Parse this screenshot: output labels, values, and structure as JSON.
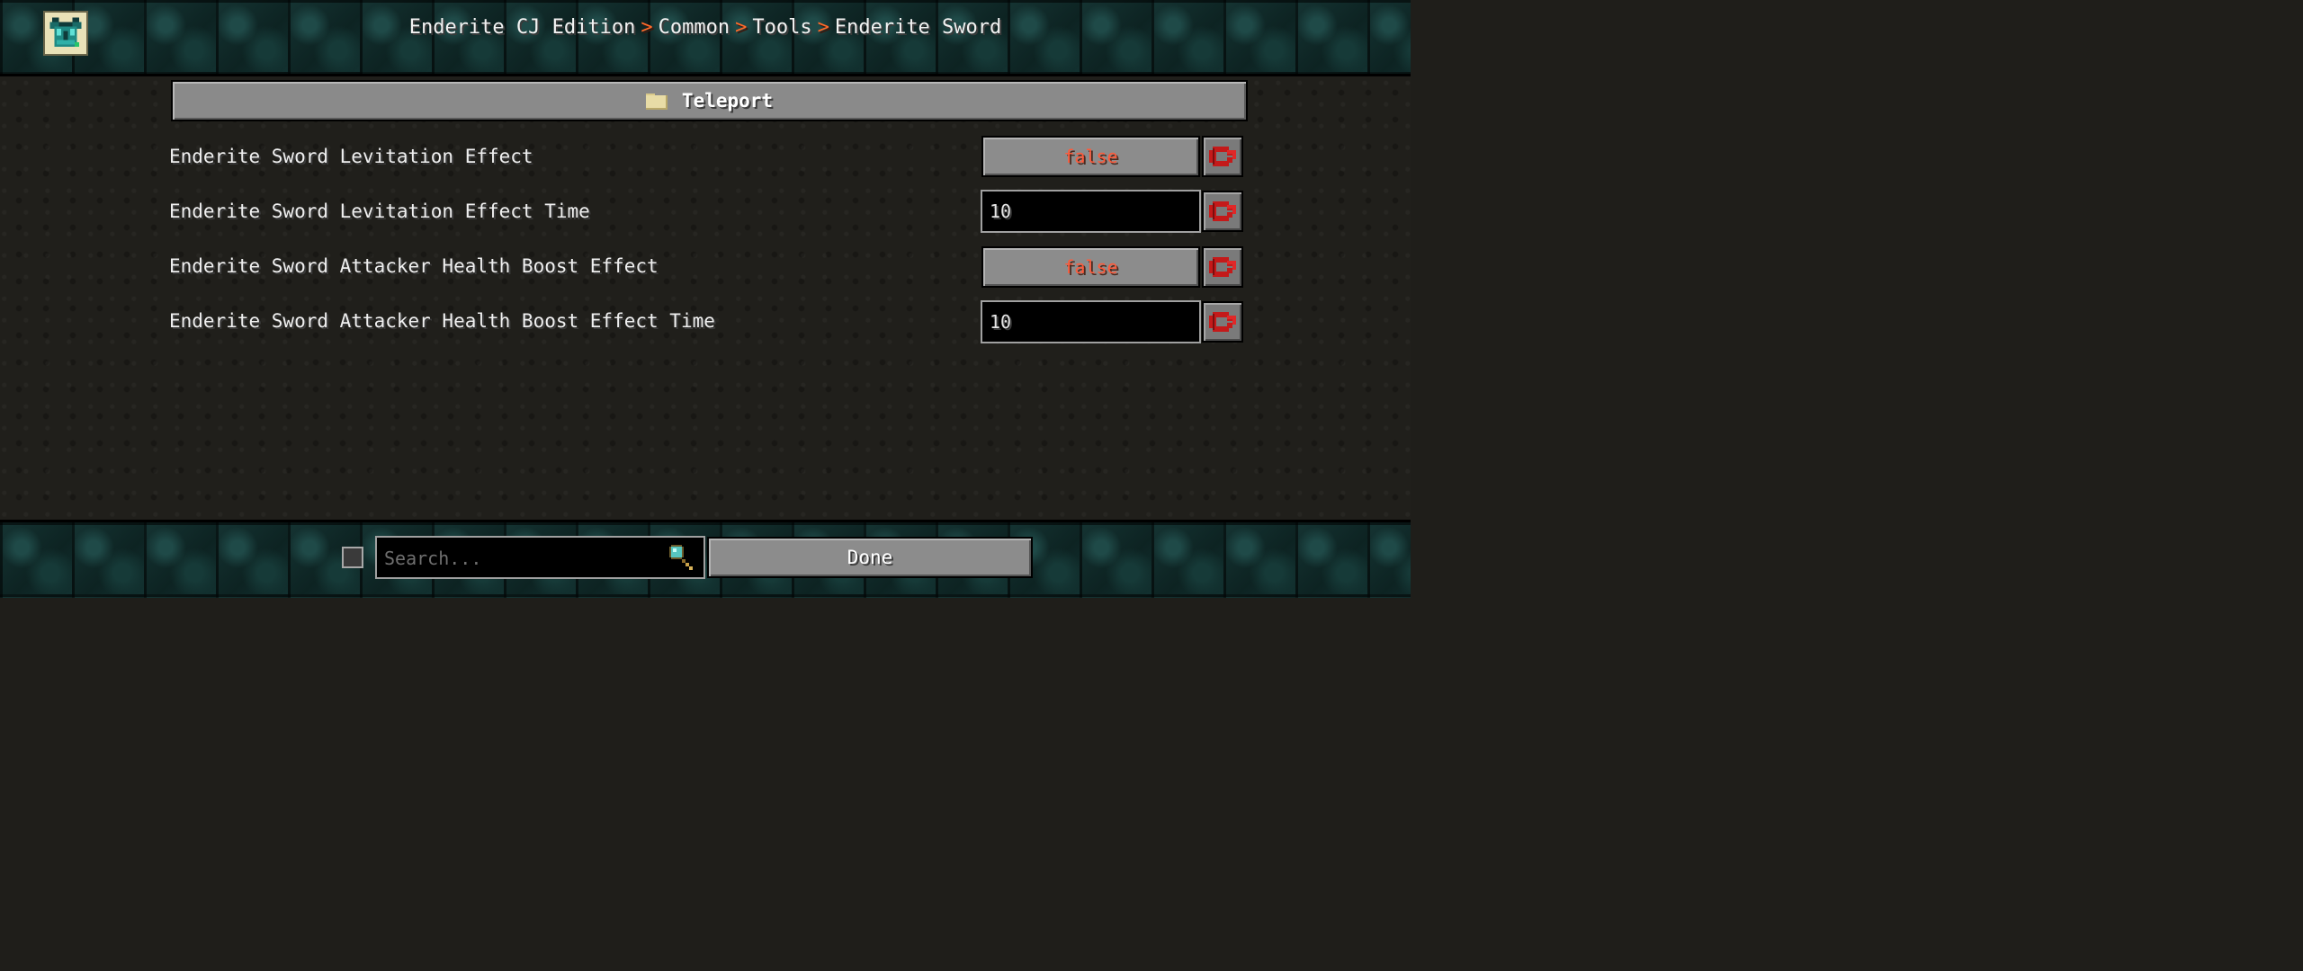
{
  "breadcrumb": {
    "items": [
      "Enderite CJ Edition",
      "Common",
      "Tools",
      "Enderite Sword"
    ],
    "separator": ">"
  },
  "logo": {
    "icon": "enderite-chestplate-icon"
  },
  "section": {
    "title": "Teleport",
    "icon": "folder-icon"
  },
  "options": [
    {
      "label": "Enderite Sword Levitation Effect",
      "type": "toggle",
      "value": "false"
    },
    {
      "label": "Enderite Sword Levitation Effect Time",
      "type": "number",
      "value": "10"
    },
    {
      "label": "Enderite Sword Attacker Health Boost Effect",
      "type": "toggle",
      "value": "false"
    },
    {
      "label": "Enderite Sword Attacker Health Boost Effect Time",
      "type": "number",
      "value": "10"
    }
  ],
  "reset_icon": "reset-arrow-icon",
  "footer": {
    "search_placeholder": "Search...",
    "search_value": "",
    "done_label": "Done"
  },
  "colors": {
    "false_value": "#ff5a3a",
    "separator": "#ff6a2a",
    "tile_bg": "#0e2424"
  }
}
